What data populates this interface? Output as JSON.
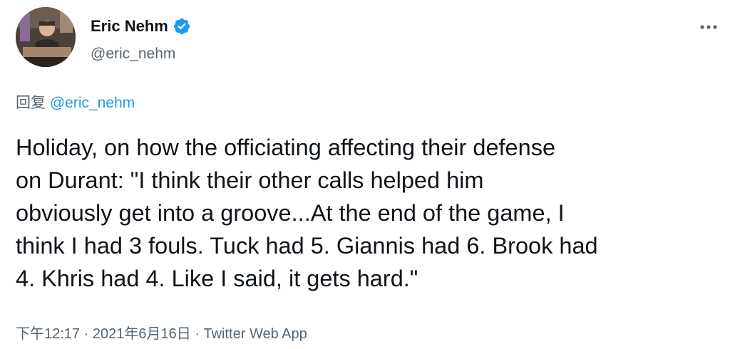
{
  "user": {
    "display_name": "Eric Nehm",
    "handle": "@eric_nehm",
    "verified": true,
    "verified_icon": "verified-badge-icon",
    "verified_color": "#1d9bf0"
  },
  "reply": {
    "prefix": "回复 ",
    "mention": "@eric_nehm"
  },
  "tweet": {
    "text": "Holiday, on how the officiating affecting their defense\non Durant: \"I think their other calls helped him\nobviously get into a groove...At the end of the game, I\nthink I had 3 fouls. Tuck had 5. Giannis had 6. Brook had\n4. Khris had 4. Like I said, it gets hard.\""
  },
  "meta": {
    "time": "下午12:17",
    "separator1": " · ",
    "date": "2021年6月16日",
    "separator2": " · ",
    "source": "Twitter Web App"
  },
  "more_icon": "more-options-icon",
  "colors": {
    "text_primary": "#0f1419",
    "text_secondary": "#536471",
    "accent": "#1d9bf0"
  }
}
